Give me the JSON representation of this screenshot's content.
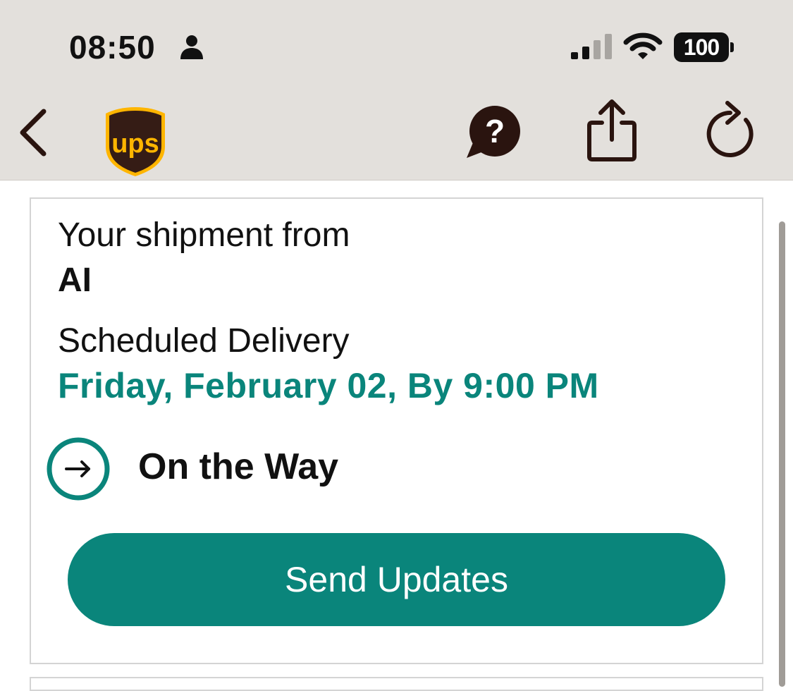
{
  "status_bar": {
    "time": "08:50",
    "battery": "100",
    "icons": [
      "person-icon",
      "cellular-signal-icon",
      "wifi-icon",
      "battery-icon"
    ]
  },
  "nav_bar": {
    "back_icon": "chevron-left-icon",
    "logo": "ups-logo",
    "logo_text": "ups",
    "actions": [
      "help-chat-icon",
      "share-icon",
      "refresh-icon"
    ]
  },
  "shipment": {
    "from_label": "Your shipment from",
    "sender": "AI",
    "scheduled_label": "Scheduled Delivery",
    "scheduled_date": "Friday, February 02, By 9:00 PM",
    "status": "On the Way",
    "status_icon": "arrow-right-circle-icon",
    "send_updates_label": "Send Updates"
  },
  "colors": {
    "accent_teal": "#0a857b",
    "topbar_bg": "#e3e0dc",
    "ups_brown": "#351c15",
    "ups_gold": "#ffb500",
    "nav_icon": "#2a140f"
  }
}
